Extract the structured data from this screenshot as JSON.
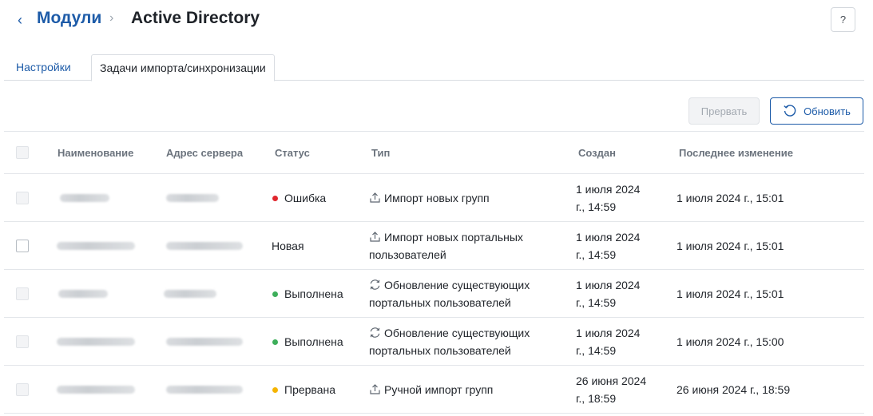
{
  "header": {
    "back_icon": "chevron-left-icon",
    "breadcrumb_link": "Модули",
    "breadcrumb_separator": "›",
    "title": "Active Directory",
    "help_label": "?"
  },
  "tabs": [
    {
      "label": "Настройки",
      "active": false
    },
    {
      "label": "Задачи импорта/синхронизации",
      "active": true
    }
  ],
  "toolbar": {
    "stop_label": "Прервать",
    "refresh_label": "Обновить",
    "refresh_icon": "refresh-icon"
  },
  "table": {
    "columns": [
      "Наименование",
      "Адрес сервера",
      "Статус",
      "Тип",
      "Создан",
      "Последнее изменение"
    ],
    "rows": [
      {
        "status": "Ошибка",
        "status_color": "#e0262d",
        "type_icon": "upload-icon",
        "type_line1": "Импорт новых групп",
        "type_line2": "",
        "created_line1": "1 июля 2024",
        "created_line2": "г., 14:59",
        "modified": "1 июля 2024 г., 15:01"
      },
      {
        "status": "Новая",
        "status_color": "",
        "type_icon": "upload-icon",
        "type_line1": "Импорт новых портальных",
        "type_line2": "пользователей",
        "created_line1": "1 июля 2024",
        "created_line2": "г., 14:59",
        "modified": "1 июля 2024 г., 15:01"
      },
      {
        "status": "Выполнена",
        "status_color": "#3dae5a",
        "type_icon": "sync-icon",
        "type_line1": "Обновление существующих",
        "type_line2": "портальных пользователей",
        "created_line1": "1 июля 2024",
        "created_line2": "г., 14:59",
        "modified": "1 июля 2024 г., 15:01"
      },
      {
        "status": "Выполнена",
        "status_color": "#3dae5a",
        "type_icon": "sync-icon",
        "type_line1": "Обновление существующих",
        "type_line2": "портальных пользователей",
        "created_line1": "1 июля 2024",
        "created_line2": "г., 14:59",
        "modified": "1 июля 2024 г., 15:00"
      },
      {
        "status": "Прервана",
        "status_color": "#f5b400",
        "type_icon": "upload-icon",
        "type_line1": "Ручной импорт групп",
        "type_line2": "",
        "created_line1": "26 июня 2024",
        "created_line2": "г., 18:59",
        "modified": "26 июня 2024 г., 18:59"
      }
    ]
  }
}
